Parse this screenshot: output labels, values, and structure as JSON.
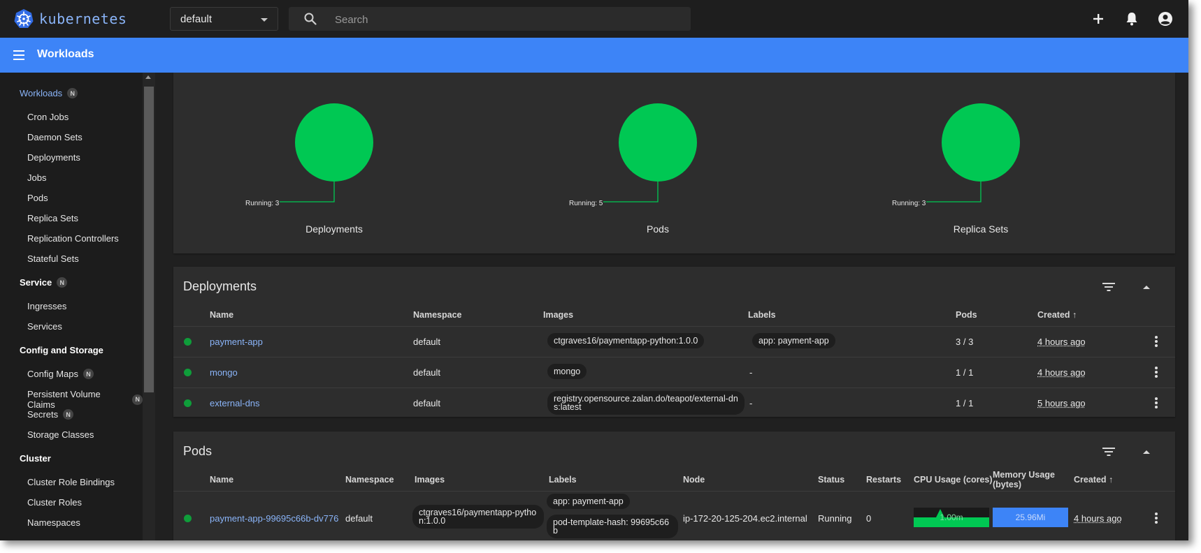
{
  "topbar": {
    "brand": "kubernetes",
    "namespace": "default",
    "search_placeholder": "Search"
  },
  "titlebar": {
    "title": "Workloads"
  },
  "sidebar": {
    "badge": "N",
    "workloads": "Workloads",
    "workload_items": [
      "Cron Jobs",
      "Daemon Sets",
      "Deployments",
      "Jobs",
      "Pods",
      "Replica Sets",
      "Replication Controllers",
      "Stateful Sets"
    ],
    "service": "Service",
    "service_items": [
      "Ingresses",
      "Services"
    ],
    "config": "Config and Storage",
    "config_items": [
      "Config Maps",
      "Persistent Volume Claims",
      "Secrets",
      "Storage Classes"
    ],
    "cluster": "Cluster",
    "cluster_items": [
      "Cluster Role Bindings",
      "Cluster Roles",
      "Namespaces"
    ]
  },
  "status": {
    "color": "#00c853",
    "items": [
      {
        "label": "Deployments",
        "running": "Running: 3"
      },
      {
        "label": "Pods",
        "running": "Running: 5"
      },
      {
        "label": "Replica Sets",
        "running": "Running: 3"
      }
    ]
  },
  "deployments": {
    "title": "Deployments",
    "headers": [
      "Name",
      "Namespace",
      "Images",
      "Labels",
      "Pods",
      "Created"
    ],
    "rows": [
      {
        "name": "payment-app",
        "namespace": "default",
        "image": "ctgraves16/paymentapp-python:1.0.0",
        "label": "app: payment-app",
        "pods": "3 / 3",
        "created": "4 hours ago"
      },
      {
        "name": "mongo",
        "namespace": "default",
        "image": "mongo",
        "label": "-",
        "pods": "1 / 1",
        "created": "4 hours ago"
      },
      {
        "name": "external-dns",
        "namespace": "default",
        "image": "registry.opensource.zalan.do/teapot/external-dns:latest",
        "label": "-",
        "pods": "1 / 1",
        "created": "5 hours ago"
      }
    ]
  },
  "pods": {
    "title": "Pods",
    "headers": [
      "Name",
      "Namespace",
      "Images",
      "Labels",
      "Node",
      "Status",
      "Restarts",
      "CPU Usage (cores)",
      "Memory Usage (bytes)",
      "Created"
    ],
    "rows": [
      {
        "name": "payment-app-99695c66b-dv776",
        "namespace": "default",
        "image": "ctgraves16/paymentapp-python:1.0.0",
        "label1": "app: payment-app",
        "label2": "pod-template-hash: 99695c66b",
        "node": "ip-172-20-125-204.ec2.internal",
        "status": "Running",
        "restarts": "0",
        "cpu": "1.00m",
        "memory": "25.96Mi",
        "created": "4 hours ago"
      }
    ]
  },
  "colors": {
    "accent": "#3d84f7",
    "link": "#8ab4f8",
    "ok": "#0f9d3a",
    "cpu": "#00c853",
    "memory": "#3d84f7"
  }
}
